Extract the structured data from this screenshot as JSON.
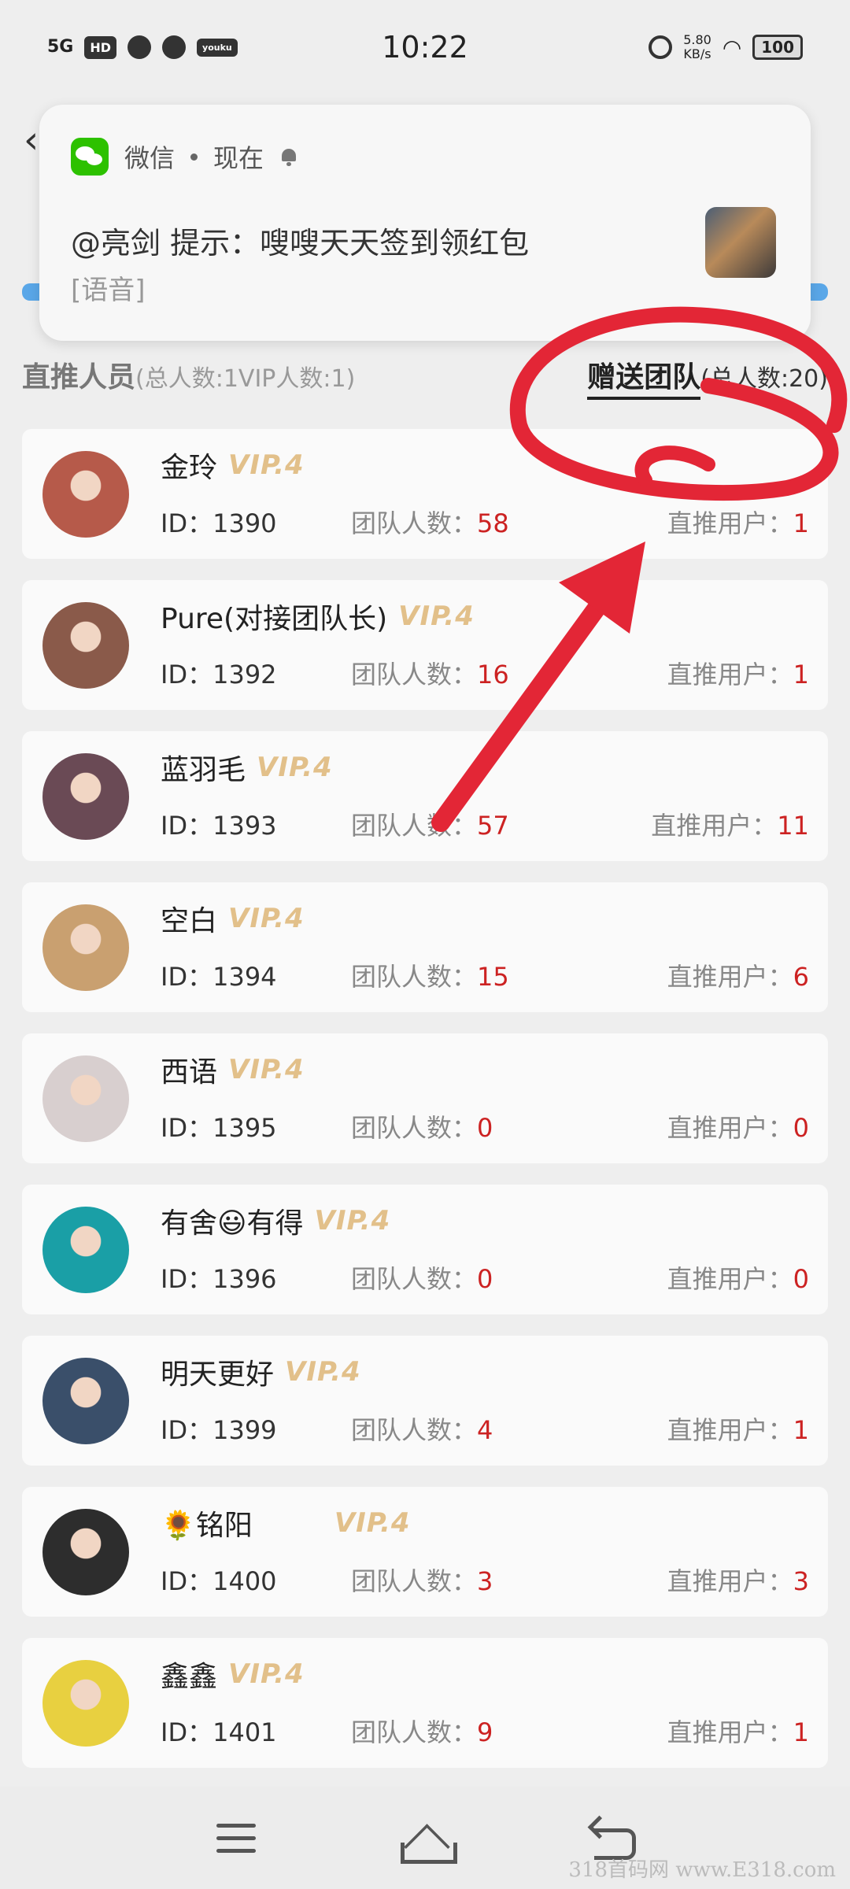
{
  "status_bar": {
    "network": "5G",
    "hd": "HD",
    "app_badge": "youku",
    "time": "10:22",
    "speed_value": "5.80",
    "speed_unit": "KB/s",
    "battery": "100"
  },
  "notification": {
    "app": "微信",
    "when": "现在",
    "message": "@亮剑  提示：嗖嗖天天签到领红包",
    "sub": "[语音]"
  },
  "section": {
    "left_title": "直推人员",
    "left_total_label": "(总人数:",
    "left_total": "1",
    "left_vip_label": "VIP人数:",
    "left_vip": "1",
    "left_close": ")",
    "right_title": "赠送团队",
    "right_total_label": "(总人数:",
    "right_total": "20",
    "right_close": ")"
  },
  "labels": {
    "id_prefix": "ID：",
    "team_prefix": "团队人数：",
    "direct_prefix": "直推用户："
  },
  "members": [
    {
      "name": "金玲",
      "vip": "VIP.4",
      "id": "1390",
      "team": "58",
      "direct": "1",
      "avatar_color": "#b65a4a"
    },
    {
      "name": "Pure(对接团队长)",
      "vip": "VIP.4",
      "id": "1392",
      "team": "16",
      "direct": "1",
      "avatar_color": "#8a5a4a"
    },
    {
      "name": "蓝羽毛",
      "vip": "VIP.4",
      "id": "1393",
      "team": "57",
      "direct": "11",
      "avatar_color": "#6a4a55"
    },
    {
      "name": "空白",
      "vip": "VIP.4",
      "id": "1394",
      "team": "15",
      "direct": "6",
      "avatar_color": "#c9a070"
    },
    {
      "name": "西语",
      "vip": "VIP.4",
      "id": "1395",
      "team": "0",
      "direct": "0",
      "avatar_color": "#d8cfcf"
    },
    {
      "name": "有舍😃有得",
      "vip": "VIP.4",
      "id": "1396",
      "team": "0",
      "direct": "0",
      "avatar_color": "#1a9fa6"
    },
    {
      "name": "明天更好",
      "vip": "VIP.4",
      "id": "1399",
      "team": "4",
      "direct": "1",
      "avatar_color": "#3a4f6a"
    },
    {
      "name": "🌻铭阳",
      "vip": "VIP.4",
      "id": "1400",
      "team": "3",
      "direct": "3",
      "avatar_color": "#2d2d2d"
    },
    {
      "name": "鑫鑫",
      "vip": "VIP.4",
      "id": "1401",
      "team": "9",
      "direct": "1",
      "avatar_color": "#e8d040"
    }
  ],
  "watermark": "318首码网  www.E318.com",
  "accent_red": "#e32636"
}
